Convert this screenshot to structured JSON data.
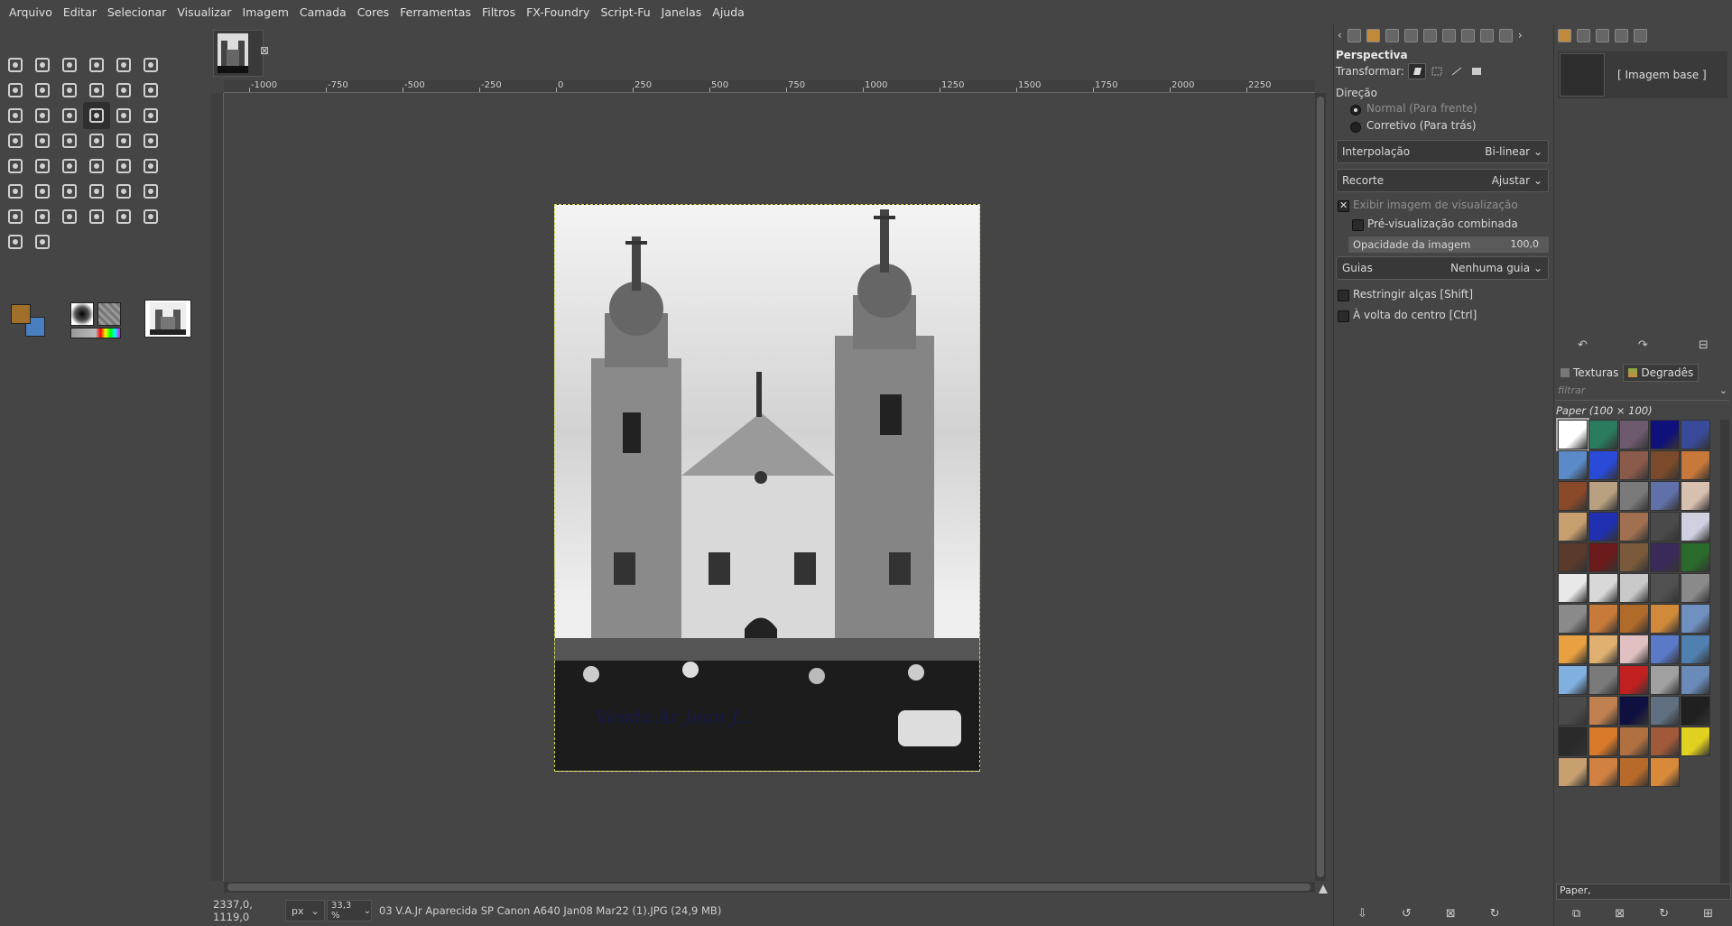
{
  "menu": [
    "Arquivo",
    "Editar",
    "Selecionar",
    "Visualizar",
    "Imagem",
    "Camada",
    "Cores",
    "Ferramentas",
    "Filtros",
    "FX-Foundry",
    "Script-Fu",
    "Janelas",
    "Ajuda"
  ],
  "image_tab": {
    "close_glyph": "⊠"
  },
  "ruler": {
    "top_labels": [
      "-1000",
      "-750",
      "-500",
      "-250",
      "0",
      "250",
      "500",
      "750",
      "1000",
      "1250",
      "1500",
      "1750",
      "2000",
      "2250",
      "2"
    ]
  },
  "canvas": {
    "watermark": "Venda Ar  Jean J..."
  },
  "status": {
    "coords": "2337,0, 1119,0",
    "unit": "px",
    "zoom": "33,3 %",
    "file": "03 V.A.Jr Aparecida SP Canon A640 Jan08 Mar22 (1).JPG (24,9 MB)"
  },
  "tool_options": {
    "title": "Perspectiva",
    "transform_label": "Transformar:",
    "direction_label": "Direção",
    "direction_normal": "Normal (Para frente)",
    "direction_corrective": "Corretivo (Para trás)",
    "interpolation_label": "Interpolação",
    "interpolation_value": "Bi-linear",
    "clipping_label": "Recorte",
    "clipping_value": "Ajustar",
    "show_preview": "Exibir imagem de visualização",
    "combined_preview": "Pré-visualização combinada",
    "opacity_label": "Opacidade da imagem",
    "opacity_value": "100,0",
    "opacity_fraction": 1.0,
    "guides_label": "Guias",
    "guides_value": "Nenhuma guia",
    "constrain": "Restringir alças [Shift]",
    "around_center": "À volta do centro [Ctrl]"
  },
  "layers": {
    "base_image": "[ Imagem base ]"
  },
  "patterns": {
    "tab_textures": "Texturas",
    "tab_gradients": "Degradês",
    "filter_placeholder": "filtrar",
    "selected_name": "Paper (100 × 100)",
    "footer_value": "Paper,",
    "swatches": [
      "#ffffff",
      "#2a7a5e",
      "#6e5a6e",
      "#10107a",
      "#3a4a9a",
      "#5a8ac8",
      "#2a4ad8",
      "#8a5a4a",
      "#7a4a2a",
      "#c8783a",
      "#8a4a2a",
      "#b8a080",
      "#7a7a7a",
      "#6070a8",
      "#d8c0b0",
      "#c8a070",
      "#2030b0",
      "#a07050",
      "#4a4a4a",
      "#d0d0e0",
      "#5a3a2a",
      "#6a1a1a",
      "#7a5a3a",
      "#3a2a5a",
      "#2a6a2a",
      "#e8e8e8",
      "#d8d8d8",
      "#c8c8c8",
      "#505050",
      "#8a8a8a",
      "#8a8a8a",
      "#c87a3a",
      "#b06a2a",
      "#d08a3a",
      "#7090c0",
      "#e8a040",
      "#e0b070",
      "#e0c0c0",
      "#5a7ac8",
      "#5080b0",
      "#80b0e0",
      "#7a7a7a",
      "#c02020",
      "#a0a0a0",
      "#6a8ab8",
      "#4a4a4a",
      "#c08050",
      "#101040",
      "#607080",
      "#202020",
      "#2a2a2a",
      "#d87a2a",
      "#b07040",
      "#a05a3a",
      "#e0d020",
      "#c8a070",
      "#d08040",
      "#b86a2a",
      "#d88a3a"
    ]
  },
  "colors": {
    "foreground": "#a0702a",
    "background": "#4a7fbf",
    "selection_outline": "#d8d84a"
  }
}
